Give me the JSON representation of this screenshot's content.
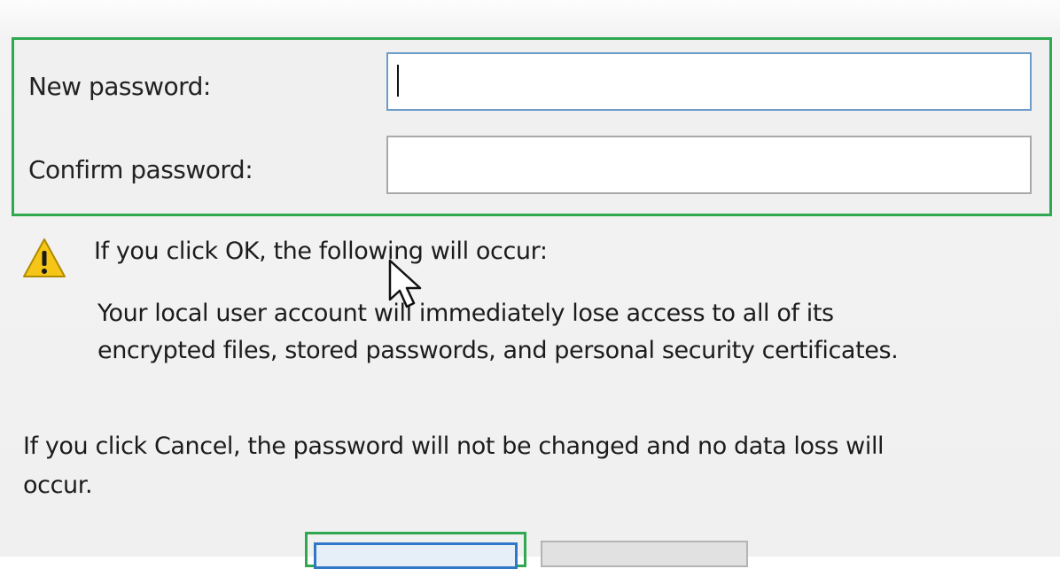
{
  "password_form": {
    "new_password_label": "New password:",
    "new_password_value": "",
    "confirm_password_label": "Confirm password:",
    "confirm_password_value": ""
  },
  "warning": {
    "icon": "warning-triangle-icon",
    "heading": "If you click OK, the following will occur:",
    "body_line_1": "Your local user account will immediately lose access to all of its",
    "body_line_2": "encrypted files, stored passwords, and personal security certificates."
  },
  "cancel_notice": {
    "line_1": "If you click Cancel, the password will not be changed and no data loss will",
    "line_2": "occur."
  },
  "buttons": {
    "ok_label": "",
    "cancel_label": ""
  },
  "colors": {
    "highlight_frame": "#2fa84f",
    "focus_blue": "#2e78c7",
    "warning_yellow": "#f5c518"
  }
}
